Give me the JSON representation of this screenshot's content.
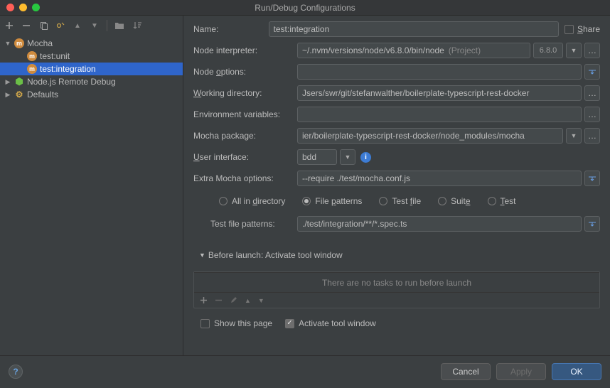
{
  "window": {
    "title": "Run/Debug Configurations"
  },
  "share": {
    "label": "Share"
  },
  "sidebar": {
    "items": [
      {
        "label": "Mocha"
      },
      {
        "label": "test:unit"
      },
      {
        "label": "test:integration"
      },
      {
        "label": "Node.js Remote Debug"
      },
      {
        "label": "Defaults"
      }
    ]
  },
  "nameField": {
    "label": "Name:",
    "value": "test:integration"
  },
  "fields": {
    "node_interpreter": {
      "label": "Node interpreter:",
      "value": "~/.nvm/versions/node/v6.8.0/bin/node",
      "hint": "(Project)",
      "version": "6.8.0"
    },
    "node_options": {
      "label": "Node options:",
      "value": ""
    },
    "working_dir": {
      "label": "Working directory:",
      "value": "Jsers/swr/git/stefanwalther/boilerplate-typescript-rest-docker"
    },
    "env_vars": {
      "label": "Environment variables:",
      "value": ""
    },
    "mocha_pkg": {
      "label": "Mocha package:",
      "value": "ier/boilerplate-typescript-rest-docker/node_modules/mocha"
    },
    "user_iface": {
      "label": "User interface:",
      "value": "bdd"
    },
    "extra_mocha": {
      "label": "Extra Mocha options:",
      "value": "--require ./test/mocha.conf.js"
    }
  },
  "testKind": {
    "options": [
      "All in directory",
      "File patterns",
      "Test file",
      "Suite",
      "Test"
    ],
    "selected": 1,
    "pattern_label": "Test file patterns:",
    "pattern_value": "./test/integration/**/*.spec.ts"
  },
  "beforeLaunch": {
    "header": "Before launch: Activate tool window",
    "empty": "There are no tasks to run before launch",
    "show_page": "Show this page",
    "activate": "Activate tool window"
  },
  "footer": {
    "cancel": "Cancel",
    "apply": "Apply",
    "ok": "OK"
  }
}
